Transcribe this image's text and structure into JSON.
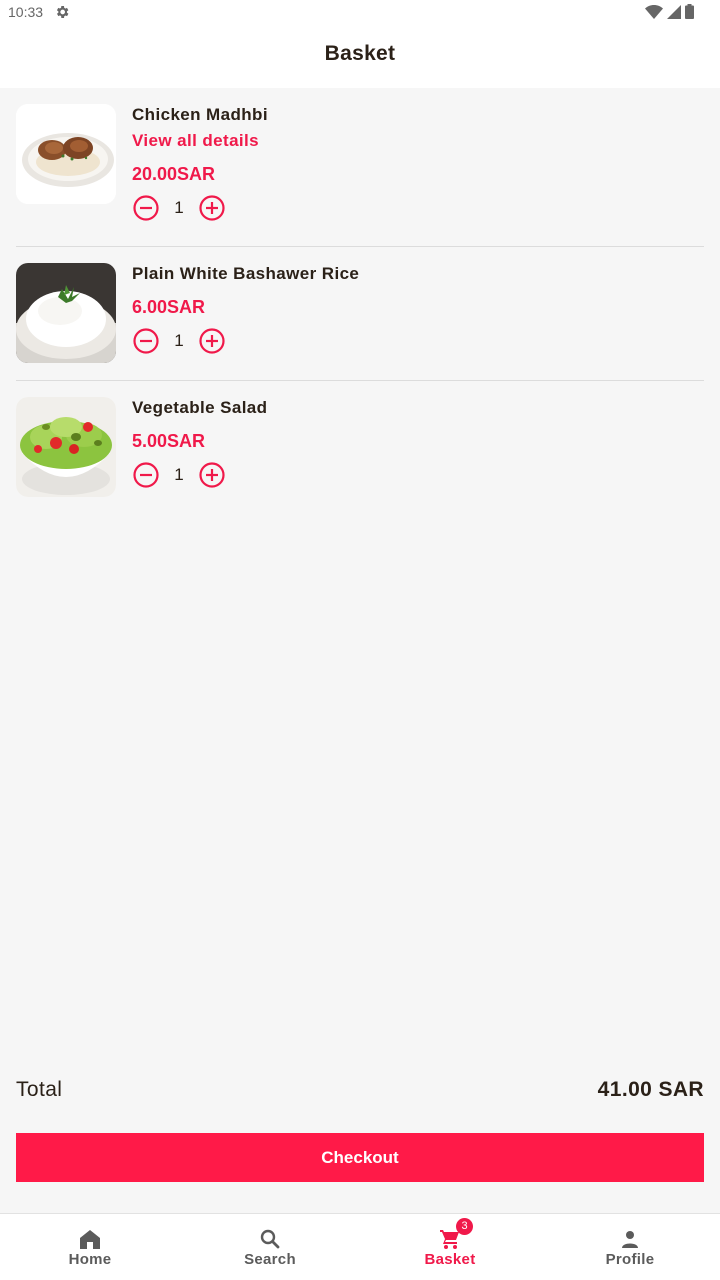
{
  "status_bar": {
    "time": "10:33"
  },
  "app_bar": {
    "title": "Basket"
  },
  "items": [
    {
      "name": "Chicken Madhbi",
      "details_link": "View all details",
      "price": "20.00SAR",
      "quantity": "1"
    },
    {
      "name": "Plain White Bashawer Rice",
      "price": "6.00SAR",
      "quantity": "1"
    },
    {
      "name": "Vegetable Salad",
      "price": "5.00SAR",
      "quantity": "1"
    }
  ],
  "total": {
    "label": "Total",
    "value": "41.00 SAR"
  },
  "checkout_label": "Checkout",
  "bottom_nav": {
    "items": [
      {
        "label": "Home",
        "icon": "home-icon"
      },
      {
        "label": "Search",
        "icon": "search-icon"
      },
      {
        "label": "Basket",
        "icon": "cart-icon",
        "badge": "3",
        "active": true
      },
      {
        "label": "Profile",
        "icon": "person-icon"
      }
    ]
  },
  "colors": {
    "accent": "#f0194a",
    "checkout": "#ff1a48",
    "text": "#2b2118",
    "background": "#f6f6f6"
  }
}
